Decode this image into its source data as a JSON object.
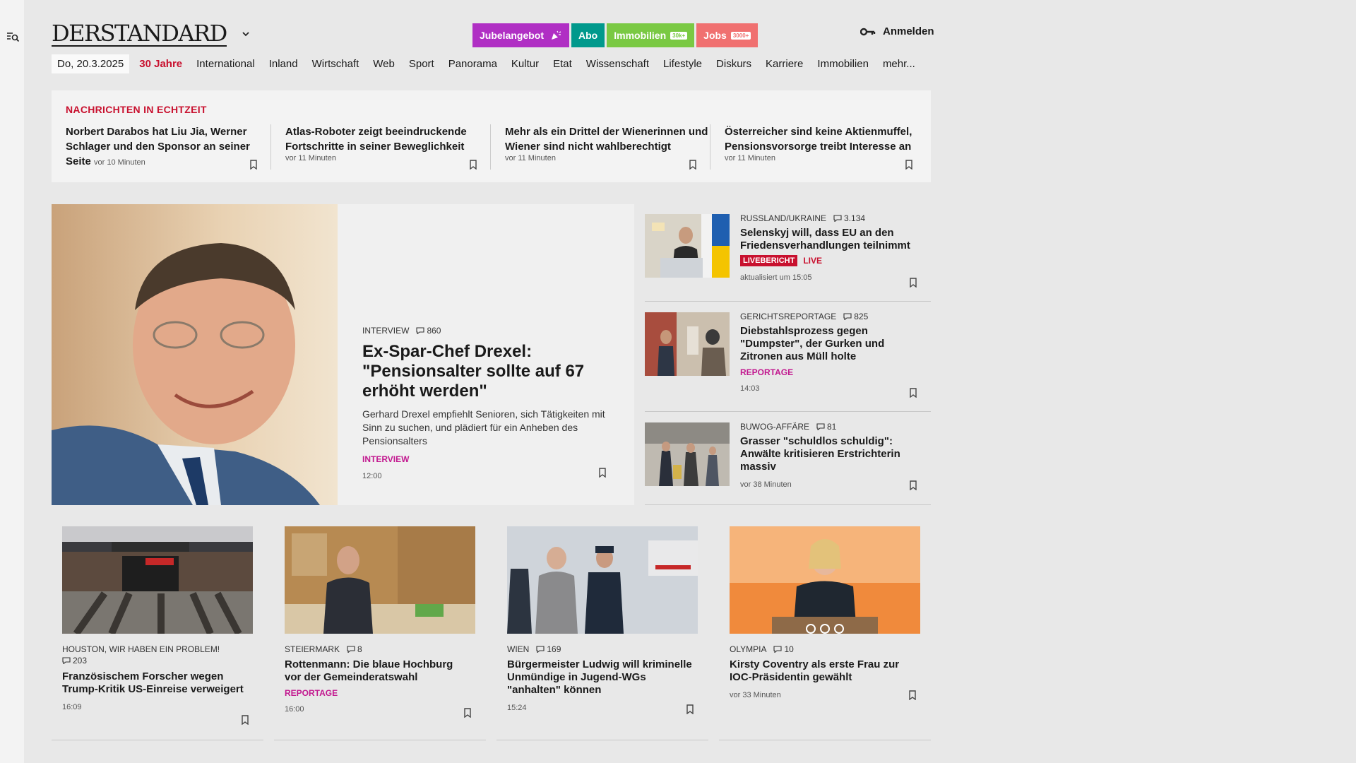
{
  "brand": {
    "logo": "DERSTANDARD"
  },
  "promo": [
    {
      "label": "Jubelangebot",
      "tag": "",
      "color": "#b02fc4"
    },
    {
      "label": "Abo",
      "tag": "",
      "color": "#00998c"
    },
    {
      "label": "Immobilien",
      "tag": "30k+",
      "color": "#7ac943"
    },
    {
      "label": "Jobs",
      "tag": "3000+",
      "color": "#f07070"
    }
  ],
  "login": {
    "label": "Anmelden"
  },
  "nav": {
    "date": "Do, 20.3.2025",
    "items": [
      "30 Jahre",
      "International",
      "Inland",
      "Wirtschaft",
      "Web",
      "Sport",
      "Panorama",
      "Kultur",
      "Etat",
      "Wissenschaft",
      "Lifestyle",
      "Diskurs",
      "Karriere",
      "Immobilien",
      "mehr..."
    ]
  },
  "ticker": {
    "title": "NACHRICHTEN IN ECHTZEIT",
    "items": [
      {
        "title": "Norbert Darabos hat Liu Jia, Werner Schlager und den Sponsor an seiner Seite",
        "time": "vor 10 Minuten"
      },
      {
        "title": "Atlas-Roboter zeigt beeindruckende Fortschritte in seiner Beweglichkeit",
        "time": "vor 11 Minuten"
      },
      {
        "title": "Mehr als ein Drittel der Wienerinnen und Wiener sind nicht wahlberechtigt",
        "time": "vor 11 Minuten"
      },
      {
        "title": "Österreicher sind keine Aktienmuffel, Pensionsvorsorge treibt Interesse an",
        "time": "vor 11 Minuten"
      }
    ]
  },
  "lead": {
    "kicker": "INTERVIEW",
    "comments": "860",
    "title": "Ex-Spar-Chef Drexel: \"Pensionsalter sollte auf 67 erhöht werden\"",
    "subtitle": "Gerhard Drexel empfiehlt Senioren, sich Tätigkeiten mit Sinn zu suchen, und plädiert für ein Anheben des Pensionsalters",
    "label": "INTERVIEW",
    "time": "12:00"
  },
  "side": [
    {
      "kicker": "RUSSLAND/UKRAINE",
      "comments": "3.134",
      "title": "Selenskyj will, dass EU an den Friedensverhandlungen teilnimmt",
      "live_badge": "LIVEBERICHT",
      "live_text": "LIVE",
      "time": "aktualisiert um 15:05"
    },
    {
      "kicker": "GERICHTSREPORTAGE",
      "comments": "825",
      "title": "Diebstahlsprozess gegen \"Dumpster\", der Gurken und Zitronen aus Müll holte",
      "label": "REPORTAGE",
      "time": "14:03"
    },
    {
      "kicker": "BUWOG-AFFÄRE",
      "comments": "81",
      "title": "Grasser \"schuldlos schuldig\": Anwälte kritisieren Erstrichterin massiv",
      "time": "vor 38 Minuten"
    }
  ],
  "cards": [
    {
      "kicker": "HOUSTON, WIR HABEN EIN PROBLEM!",
      "comments": "203",
      "title": "Französischem Forscher wegen Trump-Kritik US-Einreise verweigert",
      "time": "16:09"
    },
    {
      "kicker": "STEIERMARK",
      "comments": "8",
      "title": "Rottenmann: Die blaue Hochburg vor der Gemeinderatswahl",
      "label": "REPORTAGE",
      "time": "16:00"
    },
    {
      "kicker": "WIEN",
      "comments": "169",
      "title": "Bürgermeister Ludwig will kriminelle Unmündige in Jugend-WGs \"anhalten\" können",
      "time": "15:24"
    },
    {
      "kicker": "OLYMPIA",
      "comments": "10",
      "title": "Kirsty Coventry als erste Frau zur IOC-Präsidentin gewählt",
      "time": "vor 33 Minuten"
    }
  ],
  "icons": {
    "menu": "search-menu-icon",
    "caret": "chevron-down-icon",
    "key": "key-icon",
    "comment": "comment-icon",
    "bookmark": "bookmark-icon",
    "sparkle": "party-popper-icon"
  }
}
